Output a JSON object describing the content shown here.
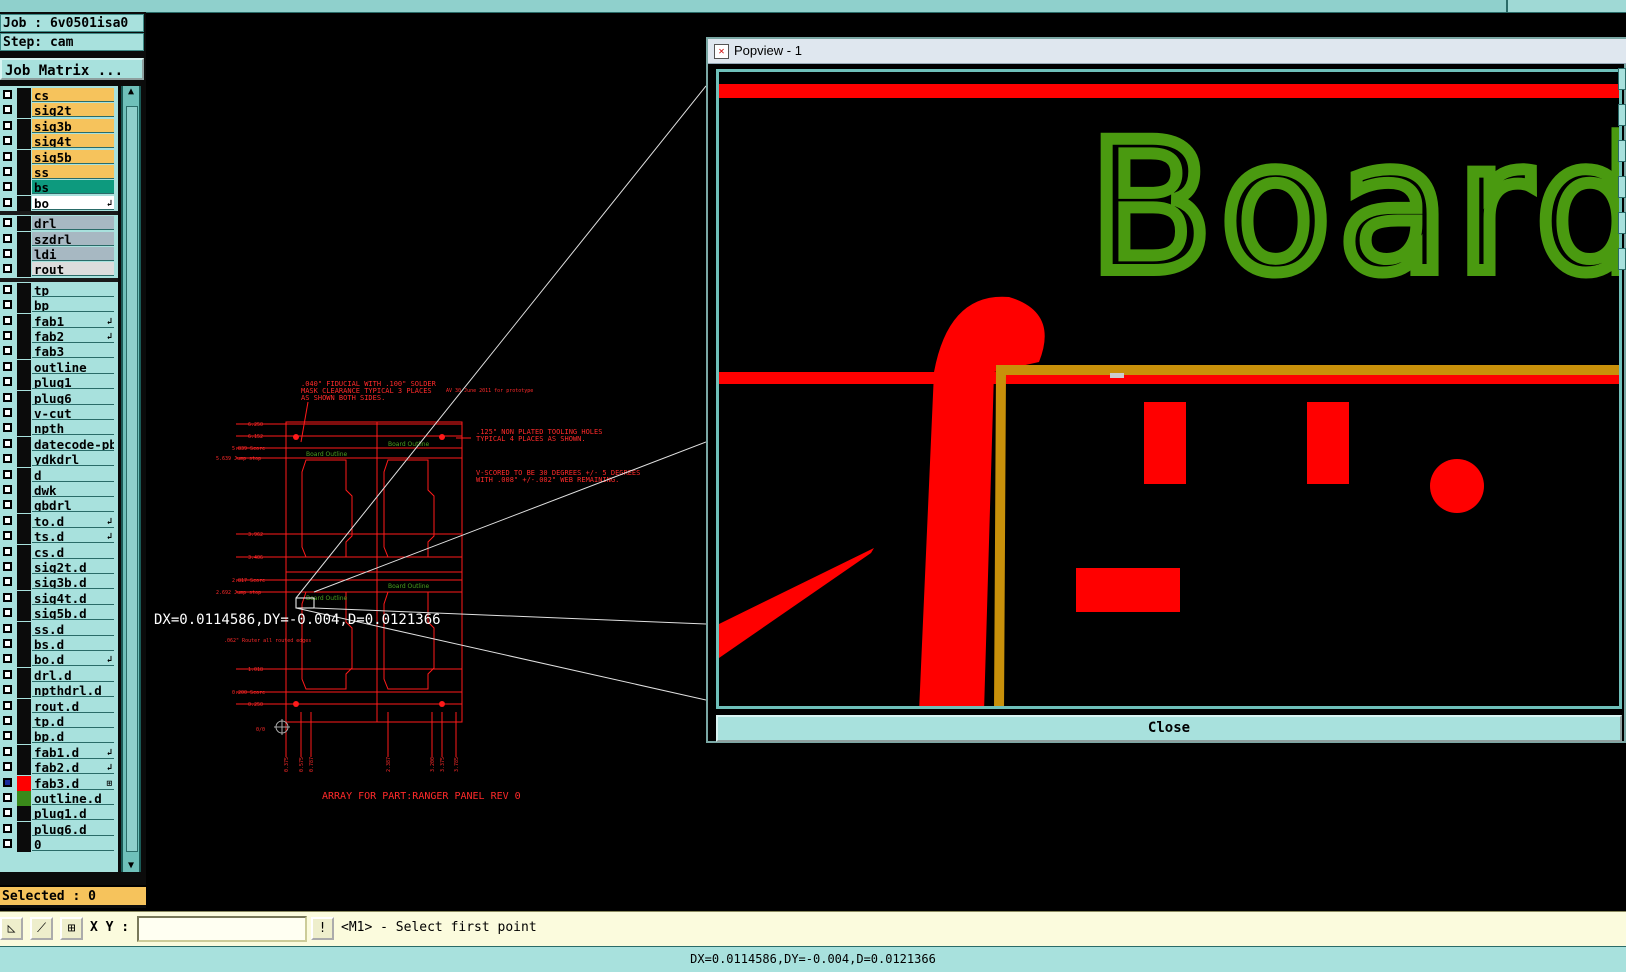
{
  "job": {
    "job_label": "Job : 6v0501isa0",
    "step_label": "Step: cam"
  },
  "job_matrix_button": "Job Matrix ...",
  "layers": [
    {
      "name": "cs",
      "color": "#f6c35c",
      "mark": ""
    },
    {
      "name": "sig2t",
      "color": "#f6c35c",
      "mark": ""
    },
    {
      "name": "sig3b",
      "color": "#f6c35c",
      "mark": ""
    },
    {
      "name": "sig4t",
      "color": "#f6c35c",
      "mark": ""
    },
    {
      "name": "sig5b",
      "color": "#f6c35c",
      "mark": ""
    },
    {
      "name": "ss",
      "color": "#f6c35c",
      "mark": ""
    },
    {
      "name": "bs",
      "color": "#0d9a7e",
      "mark": ""
    },
    {
      "name": "bo",
      "color": "#ffffff",
      "mark": "↲"
    },
    {
      "name": "drl",
      "color": "#a7b8c2",
      "mark": ""
    },
    {
      "name": "szdrl",
      "color": "#a7b8c2",
      "mark": ""
    },
    {
      "name": "ldi",
      "color": "#a7b8c2",
      "mark": ""
    },
    {
      "name": "rout",
      "color": "#dcdcdc",
      "mark": ""
    },
    {
      "name": "tp",
      "color": "#a8e1dd",
      "mark": ""
    },
    {
      "name": "bp",
      "color": "#a8e1dd",
      "mark": ""
    },
    {
      "name": "fab1",
      "color": "#a8e1dd",
      "mark": "↲"
    },
    {
      "name": "fab2",
      "color": "#a8e1dd",
      "mark": "↲"
    },
    {
      "name": "fab3",
      "color": "#a8e1dd",
      "mark": ""
    },
    {
      "name": "outline",
      "color": "#a8e1dd",
      "mark": ""
    },
    {
      "name": "plug1",
      "color": "#a8e1dd",
      "mark": ""
    },
    {
      "name": "plug6",
      "color": "#a8e1dd",
      "mark": ""
    },
    {
      "name": "v-cut",
      "color": "#a8e1dd",
      "mark": ""
    },
    {
      "name": "npth",
      "color": "#a8e1dd",
      "mark": ""
    },
    {
      "name": "datecode-pbe",
      "color": "#a8e1dd",
      "mark": ""
    },
    {
      "name": "ydkdrl",
      "color": "#a8e1dd",
      "mark": ""
    },
    {
      "name": "d",
      "color": "#a8e1dd",
      "mark": ""
    },
    {
      "name": "dwk",
      "color": "#a8e1dd",
      "mark": ""
    },
    {
      "name": "gbdrl",
      "color": "#a8e1dd",
      "mark": ""
    },
    {
      "name": "to.d",
      "color": "#a8e1dd",
      "mark": "↲"
    },
    {
      "name": "ts.d",
      "color": "#a8e1dd",
      "mark": "↲"
    },
    {
      "name": "cs.d",
      "color": "#a8e1dd",
      "mark": ""
    },
    {
      "name": "sig2t.d",
      "color": "#a8e1dd",
      "mark": ""
    },
    {
      "name": "sig3b.d",
      "color": "#a8e1dd",
      "mark": ""
    },
    {
      "name": "sig4t.d",
      "color": "#a8e1dd",
      "mark": ""
    },
    {
      "name": "sig5b.d",
      "color": "#a8e1dd",
      "mark": ""
    },
    {
      "name": "ss.d",
      "color": "#a8e1dd",
      "mark": ""
    },
    {
      "name": "bs.d",
      "color": "#a8e1dd",
      "mark": ""
    },
    {
      "name": "bo.d",
      "color": "#a8e1dd",
      "mark": "↲"
    },
    {
      "name": "drl.d",
      "color": "#a8e1dd",
      "mark": ""
    },
    {
      "name": "npthdrl.d",
      "color": "#a8e1dd",
      "mark": ""
    },
    {
      "name": "rout.d",
      "color": "#a8e1dd",
      "mark": ""
    },
    {
      "name": "tp.d",
      "color": "#a8e1dd",
      "mark": ""
    },
    {
      "name": "bp.d",
      "color": "#a8e1dd",
      "mark": ""
    },
    {
      "name": "fab1.d",
      "color": "#a8e1dd",
      "mark": "↲"
    },
    {
      "name": "fab2.d",
      "color": "#a8e1dd",
      "mark": "↲"
    },
    {
      "name": "fab3.d",
      "color": "#a8e1dd",
      "mark": "⊞",
      "active": "#ff0000",
      "checkColor": "#1a2a9a"
    },
    {
      "name": "outline.d",
      "color": "#a8e1dd",
      "mark": "",
      "active": "#3a8a1a"
    },
    {
      "name": "plug1.d",
      "color": "#a8e1dd",
      "mark": ""
    },
    {
      "name": "plug6.d",
      "color": "#a8e1dd",
      "mark": ""
    },
    {
      "name": "0",
      "color": "#a8e1dd",
      "mark": ""
    }
  ],
  "selected_label": "Selected : 0",
  "command": {
    "xy_label": "X Y :",
    "xy_value": "",
    "prompt": "<M1> - Select first point"
  },
  "measure_readout": "DX=0.0114586,DY=-0.004,D=0.0121366",
  "status_text": "DX=0.0114586,DY=-0.004,D=0.0121366",
  "popview": {
    "title": "Popview - 1",
    "close_label": "Close",
    "zoom_text": "Board"
  },
  "drawing": {
    "notes": [
      ".040\" FIDUCIAL WITH .100\" SOLDER",
      "MASK CLEARANCE TYPICAL 3 PLACES",
      "AS SHOWN BOTH SIDES.",
      ".125\" NON PLATED TOOLING HOLES",
      "TYPICAL 4 PLACES AS SHOWN.",
      "V-SCORED TO BE 30 DEGREES +/- 5 DEGREES",
      "WITH .008\" +/-.002\" WEB REMAINING."
    ],
    "side_note": "AV 30 June 2011\nfor prototype",
    "left_dims": [
      "6.250",
      "6.152",
      "5.839 Score",
      "5.639 Jump stop",
      "3.962",
      "3.406",
      "2.817 Score",
      "2.692 Jump stop",
      "1.018",
      "0.200 Score",
      "0.250",
      "0/0"
    ],
    "bottom_dims": [
      "0.375",
      "0.575",
      "0.787",
      "2.387",
      "3.200",
      "3.375",
      "3.785"
    ],
    "outline_labels": [
      "Board Outline",
      "Board Outline",
      "Board Outline",
      "Board Outline"
    ],
    "hole_note": ".062\" Router\nall routed edges",
    "array_title": "ARRAY FOR PART:RANGER PANEL REV 0"
  },
  "colors": {
    "accent": "#a8e1dd",
    "copper": "#ff0000",
    "silk": "#4a9a10",
    "outline": "#c8900a"
  }
}
